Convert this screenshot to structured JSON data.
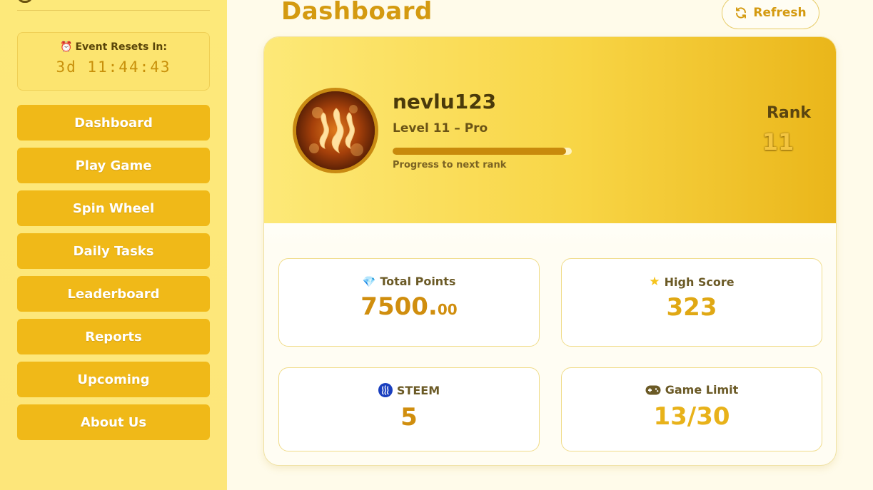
{
  "sidebar": {
    "timer": {
      "label": "Event Resets In:",
      "value": "3d 11:44:43",
      "icon": "alarm-clock-icon"
    },
    "items": [
      {
        "label": "Dashboard"
      },
      {
        "label": "Play Game"
      },
      {
        "label": "Spin Wheel"
      },
      {
        "label": "Daily Tasks"
      },
      {
        "label": "Leaderboard"
      },
      {
        "label": "Reports"
      },
      {
        "label": "Upcoming"
      },
      {
        "label": "About Us"
      }
    ]
  },
  "header": {
    "title": "Dashboard",
    "refresh_label": "Refresh",
    "refresh_icon": "refresh-icon"
  },
  "profile": {
    "username": "nevlu123",
    "level": "Level 11 – Pro",
    "progress_label": "Progress to next rank",
    "progress_fraction": 0.97,
    "rank_label": "Rank",
    "rank_value": "11"
  },
  "stats": {
    "total_points": {
      "title": "Total Points",
      "value_main": "7500.",
      "value_decimal": "00",
      "icon": "gem-icon"
    },
    "high_score": {
      "title": "High Score",
      "value": "323",
      "icon": "star-icon"
    },
    "steem": {
      "title": "STEEM",
      "value": "5",
      "icon": "steem-icon"
    },
    "game_limit": {
      "title": "Game Limit",
      "value": "13/30",
      "icon": "gamepad-icon"
    }
  },
  "colors": {
    "sidebar_bg": "#fde97a",
    "nav_button": "#f0b918",
    "accent_text": "#d49a10",
    "page_bg": "#fffbea"
  }
}
